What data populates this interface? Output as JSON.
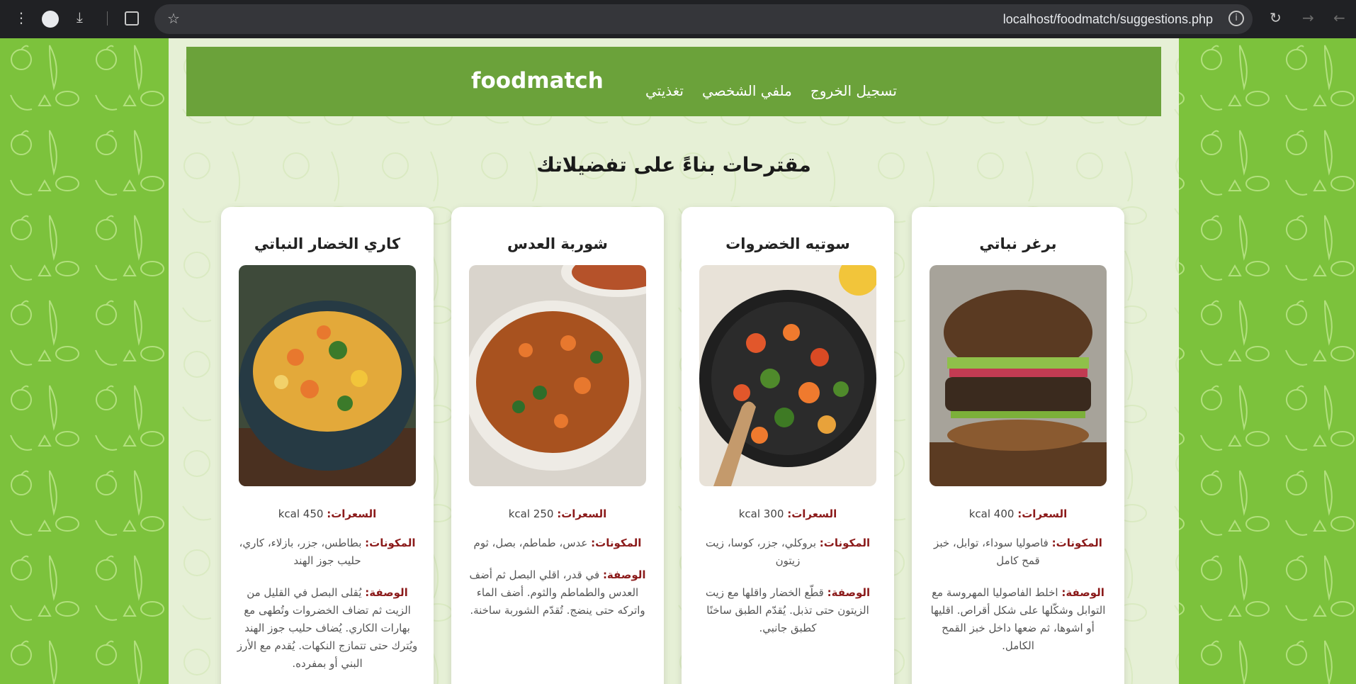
{
  "browser": {
    "url": "localhost/foodmatch/suggestions.php"
  },
  "nav": {
    "brand": "foodmatch",
    "links": [
      "تسجيل الخروج",
      "ملفي الشخصي",
      "تغذيتي"
    ]
  },
  "page": {
    "title": "مقترحات بناءً على تفضيلاتك"
  },
  "labels": {
    "calories": "السعرات:",
    "ingredients": "المكونات:",
    "description": "الوصفة:"
  },
  "recipes": [
    {
      "name": "برغر نباتي",
      "calories": "400 kcal",
      "ingredients": "فاصوليا سوداء، توابل، خبز قمح كامل",
      "description": "اخلط الفاصوليا المهروسة مع التوابل وشكّلها على شكل أقراص. اقليها أو اشوها، ثم ضعها داخل خبز القمح الكامل."
    },
    {
      "name": "سوتيه الخضروات",
      "calories": "300 kcal",
      "ingredients": "بروكلي، جزر، كوسا، زيت زيتون",
      "description": "قطّع الخضار واقلها مع زيت الزيتون حتى تذبل. يُقدّم الطبق ساخنًا كطبق جانبي."
    },
    {
      "name": "شوربة العدس",
      "calories": "250 kcal",
      "ingredients": "عدس، طماطم، بصل، ثوم",
      "description": "في قدر، اقلي البصل ثم أضف العدس والطماطم والثوم. أضف الماء واتركه حتى ينضج. تُقدّم الشوربة ساخنة."
    },
    {
      "name": "كاري الخضار النباتي",
      "calories": "450 kcal",
      "ingredients": "بطاطس، جزر، بازلاء، كاري، حليب جوز الهند",
      "description": "يُقلى البصل في القليل من الزيت ثم تضاف الخضروات وتُطهى مع بهارات الكاري. يُضاف حليب جوز الهند ويُترك حتى تتمازج النكهات. يُقدم مع الأرز البني أو بمفرده."
    }
  ],
  "colors": {
    "navbar": "#6ba23a",
    "background": "#7cc23c",
    "label": "#8b1a1a"
  }
}
